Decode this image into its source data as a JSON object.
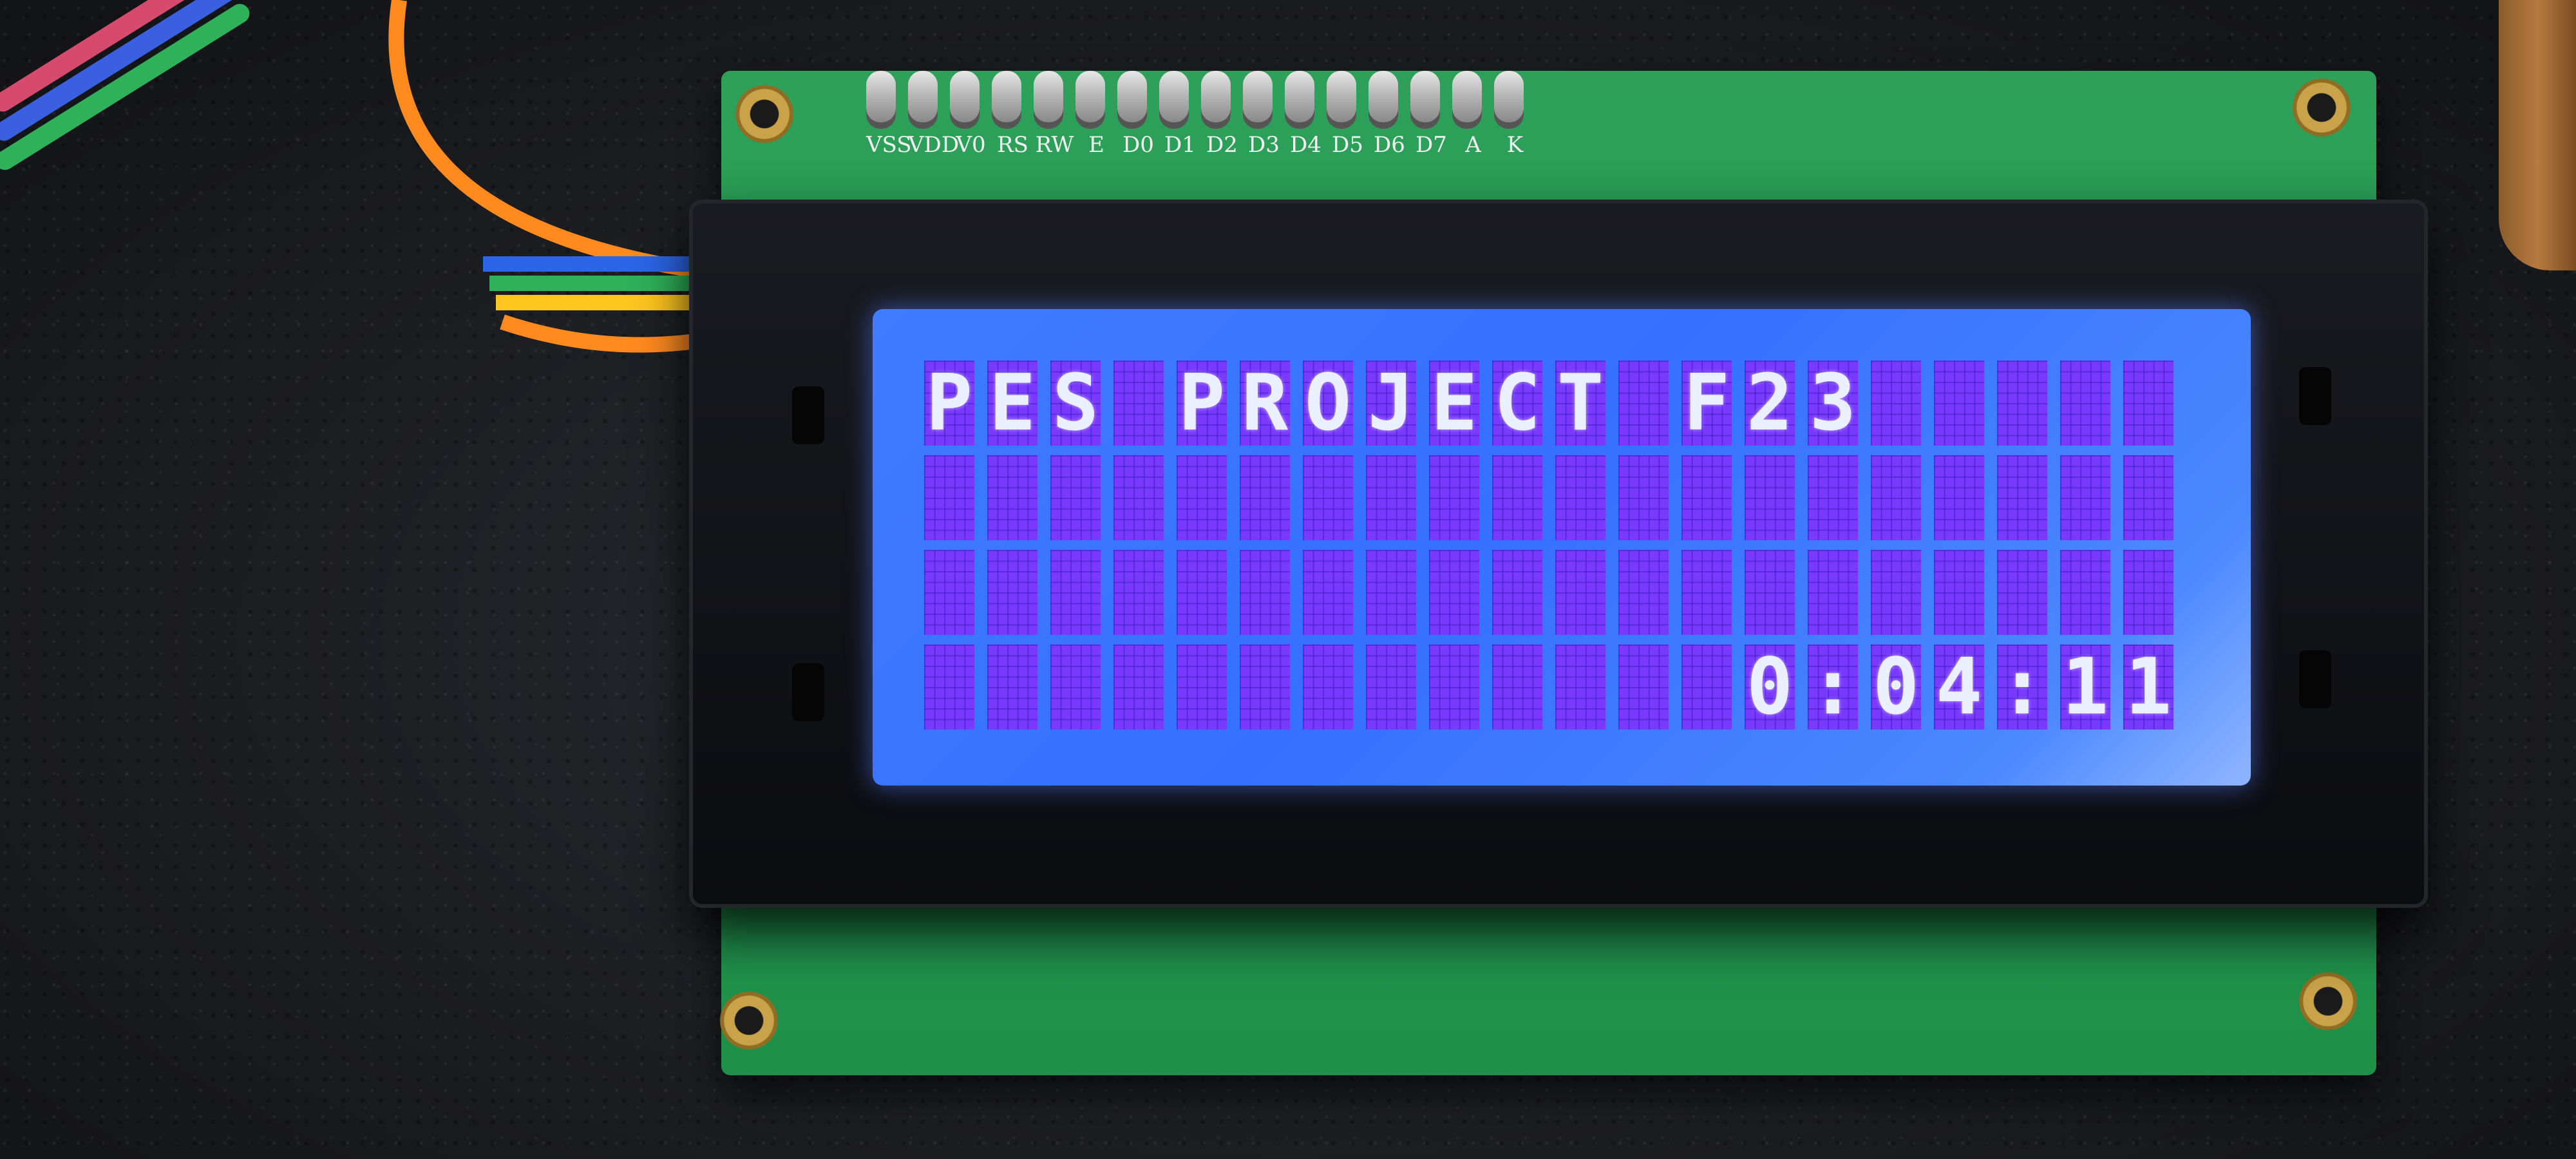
{
  "pin_labels": [
    "VSS",
    "VDD",
    "V0",
    "RS",
    "RW",
    "E",
    "D0",
    "D1",
    "D2",
    "D3",
    "D4",
    "D5",
    "D6",
    "D7",
    "A",
    "K"
  ],
  "display": {
    "line1": "PES PROJECT F23",
    "line4": "0:04:11"
  },
  "colors": {
    "lcd_background": "#3f7cff",
    "pixel_cell": "#7a39ff",
    "character": "#eaf0ff",
    "pcb": "#239a50"
  }
}
